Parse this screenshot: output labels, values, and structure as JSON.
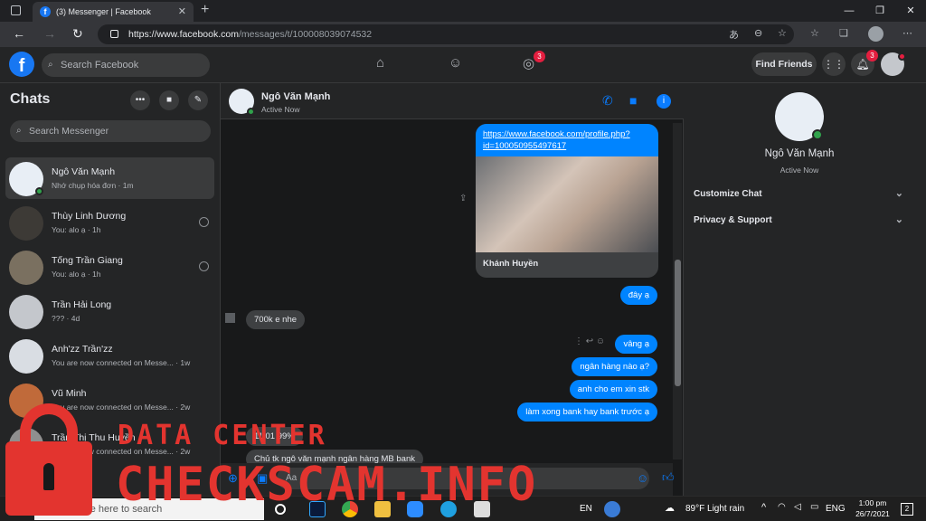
{
  "browser": {
    "tab_title": "(3) Messenger | Facebook",
    "favicon_letter": "f",
    "url_host": "https://www.facebook.com",
    "url_path": "/messages/t/100008039074532"
  },
  "facebook": {
    "logo_letter": "f",
    "search_placeholder": "Search Facebook",
    "friends_badge": "3",
    "notif_badge": "3",
    "find_friends_label": "Find Friends"
  },
  "sidebar": {
    "title": "Chats",
    "search_placeholder": "Search Messenger",
    "conversations": [
      {
        "name": "Ngô Văn Mạnh",
        "snippet": "Nhớ chụp hóa đơn · 1m",
        "avatar_color": "#e8eef5"
      },
      {
        "name": "Thùy Linh Dương",
        "snippet": "You: alo ạ · 1h",
        "avatar_color": "#3d3a36"
      },
      {
        "name": "Tống Trần Giang",
        "snippet": "You: alo ạ · 1h",
        "avatar_color": "#7a7060"
      },
      {
        "name": "Trần Hải Long",
        "snippet": "??? · 4d",
        "avatar_color": "#c4c7cc"
      },
      {
        "name": "Anh'zz Trần'zz",
        "snippet": "You are now connected on Messe... · 1w",
        "avatar_color": "#d9dde3"
      },
      {
        "name": "Vũ Minh",
        "snippet": "You are now connected on Messe... · 2w",
        "avatar_color": "#c06a3a"
      },
      {
        "name": "Trần Thị Thu Huyền",
        "snippet": "You are now connected on Messe... · 2w",
        "avatar_color": "#8f8f8f"
      }
    ]
  },
  "chat": {
    "contact_name": "Ngô Văn Mạnh",
    "contact_status": "Active Now",
    "link_url": "https://www.facebook.com/profile.php?id=100050955497617",
    "link_caption": "Khánh Huyền",
    "messages_out": [
      "đây ạ",
      "vâng ạ",
      "ngân hàng nào ạ?",
      "anh cho em xin stk",
      "làm xong bank hay bank trước ạ"
    ],
    "messages_in": [
      "700k e nhe",
      "11 01 99%",
      "Chủ tk ngô văn mạnh ngân hàng MB bank"
    ],
    "composer_placeholder": "Aa"
  },
  "info_panel": {
    "name": "Ngô Văn Mạnh",
    "status": "Active Now",
    "sections": [
      "Customize Chat",
      "Privacy & Support"
    ]
  },
  "watermark": {
    "line1": "DATA CENTER",
    "line2": "CHECKSCAM.INFO"
  },
  "taskbar": {
    "search_placeholder": "Type here to search",
    "lang_short": "EN",
    "weather": "89°F  Light rain",
    "lang": "ENG",
    "time": "1:00 pm",
    "date": "26/7/2021",
    "notif_count": "2"
  },
  "colors": {
    "accent": "#0084ff",
    "fb_blue": "#1877f2",
    "badge_red": "#e41e3f",
    "watermark_red": "#e3342f"
  }
}
